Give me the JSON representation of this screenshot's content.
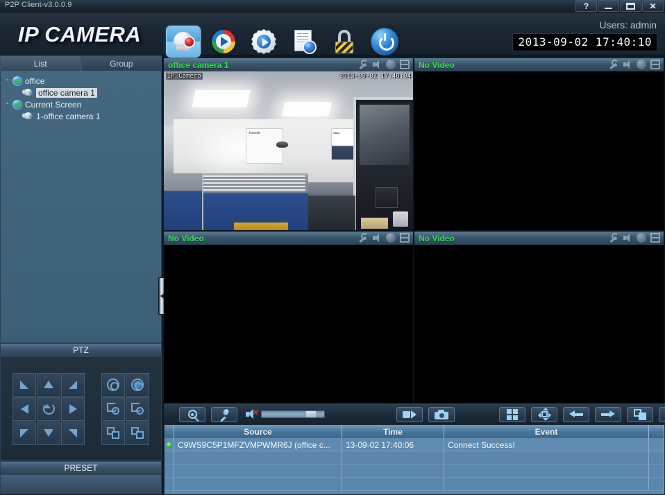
{
  "window": {
    "app_title": "P2P Client-v3.0.0.9",
    "help_label": "?",
    "close_label": "✕"
  },
  "header": {
    "logo": "IP CAMERA",
    "users_label": "Users: admin",
    "clock": "2013-09-02 17:40:10",
    "toolbar": [
      {
        "name": "live-view",
        "icon": "camera-dome-icon",
        "active": true
      },
      {
        "name": "playback",
        "icon": "playback-icon",
        "active": false
      },
      {
        "name": "settings",
        "icon": "gear-icon",
        "active": false
      },
      {
        "name": "log",
        "icon": "log-icon",
        "active": false
      },
      {
        "name": "lock",
        "icon": "lock-icon",
        "active": false
      },
      {
        "name": "power",
        "icon": "power-icon",
        "active": false
      }
    ]
  },
  "sidebar": {
    "tabs": [
      {
        "label": "List",
        "active": true
      },
      {
        "label": "Group",
        "active": false
      }
    ],
    "tree": [
      {
        "label": "office",
        "type": "group",
        "expander": "-",
        "depth": 0,
        "selected": false
      },
      {
        "label": "office camera 1",
        "type": "camera",
        "expander": "",
        "depth": 1,
        "selected": true
      },
      {
        "label": "Current Screen",
        "type": "group",
        "expander": "-",
        "depth": 0,
        "selected": false
      },
      {
        "label": "1-office camera 1",
        "type": "camera",
        "expander": "",
        "depth": 1,
        "selected": false
      }
    ],
    "ptz_title": "PTZ",
    "preset_title": "PRESET",
    "ptz_buttons": [
      "pan-up-left",
      "pan-up",
      "pan-up-right",
      "pan-left",
      "auto-rotate",
      "pan-right",
      "pan-down-left",
      "pan-down",
      "pan-down-right"
    ],
    "lens_buttons": [
      "iris-open",
      "iris-close",
      "zoom-in",
      "zoom-out",
      "focus-near",
      "focus-far"
    ]
  },
  "videos": [
    {
      "title": "office camera 1",
      "selected": true,
      "has_video": true,
      "overlay_name": "IP Camera",
      "overlay_time": "2013-09-02 17:40:04"
    },
    {
      "title": "No Video",
      "selected": false,
      "has_video": false
    },
    {
      "title": "No Video",
      "selected": false,
      "has_video": false
    },
    {
      "title": "No Video",
      "selected": false,
      "has_video": false
    }
  ],
  "video_icons": [
    "wrench-icon",
    "speaker-icon",
    "record-icon",
    "split-view-icon"
  ],
  "controls": {
    "left": [
      {
        "name": "search-button",
        "icon": "search-icon"
      },
      {
        "name": "talk-button",
        "icon": "microphone-icon"
      }
    ],
    "volume": {
      "icon": "speaker-muted-icon",
      "value": 75
    },
    "capture": [
      {
        "name": "record-button",
        "icon": "record-arrow-icon"
      },
      {
        "name": "snapshot-button",
        "icon": "camera-snapshot-icon"
      }
    ],
    "layout": [
      {
        "name": "split-4-button",
        "icon": "grid-4-icon"
      },
      {
        "name": "fullscreen-button",
        "icon": "fit-screen-icon"
      },
      {
        "name": "previous-button",
        "icon": "arrow-left-icon"
      },
      {
        "name": "next-button",
        "icon": "arrow-right-icon"
      },
      {
        "name": "auto-cycle-button",
        "icon": "cycle-icon"
      },
      {
        "name": "expand-button",
        "icon": "double-chevron-down-icon"
      }
    ]
  },
  "events": {
    "columns": [
      "",
      "Source",
      "Time",
      "Event",
      ""
    ],
    "rows": [
      {
        "status": "online",
        "source": "C9WS9C5P1MFZVMPWMR6J (office c...",
        "time": "13-09-02 17:40:06",
        "event": "Connect Success!"
      }
    ]
  },
  "colors": {
    "accent": "#31e34a",
    "selection": "#c04fd0",
    "panel": "#2c3e50",
    "status_online": "#2fc22f"
  }
}
